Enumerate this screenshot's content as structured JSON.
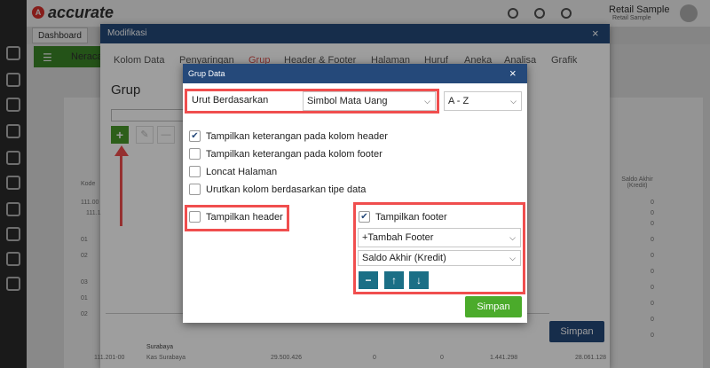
{
  "app": {
    "logo_text": "accurate",
    "user_name": "Retail Sample",
    "user_subtitle": "Retail Sample",
    "tab_dashboard": "Dashboard",
    "page_title": "Neraca"
  },
  "modifikasi": {
    "title": "Modifikasi",
    "close": "×",
    "tabs": [
      "Kolom Data",
      "Penyaringan",
      "Grup",
      "Header & Footer",
      "Halaman",
      "Huruf",
      "Aneka",
      "Analisa",
      "Grafik"
    ],
    "active_tab": "Grup",
    "section_title": "Grup",
    "add_icon": "+",
    "edit_icon": "✎",
    "delete_icon": "—",
    "save_button": "Simpan"
  },
  "background_report": {
    "col_kode": "Kode",
    "col_saldo": "Saldo Akhir (Kredit)",
    "row_codes": [
      "111.00",
      "111.1",
      "01",
      "02",
      "03",
      "01",
      "02",
      "03",
      "04"
    ],
    "zeros": [
      "0",
      "0",
      "0",
      "0",
      "0",
      "0",
      "0",
      "0",
      "0",
      "0"
    ],
    "footer_row": {
      "group": "Surabaya",
      "code": "111.201-00",
      "name": "Kas Surabaya",
      "v1": "29.500.426",
      "v2": "0",
      "v3": "0",
      "v4": "1.441.298",
      "v5": "28.061.128"
    }
  },
  "grup_dialog": {
    "title": "Grup Data",
    "close": "×",
    "sort_label": "Urut Berdasarkan",
    "sort_field": "Simbol Mata Uang",
    "sort_order": "A - Z",
    "options": [
      {
        "label": "Tampilkan keterangan pada kolom header",
        "checked": true
      },
      {
        "label": "Tampilkan keterangan pada kolom footer",
        "checked": false
      },
      {
        "label": "Loncat Halaman",
        "checked": false
      },
      {
        "label": "Urutkan kolom berdasarkan tipe data",
        "checked": false
      }
    ],
    "show_header": {
      "label": "Tampilkan header",
      "checked": false
    },
    "show_footer": {
      "label": "Tampilkan footer",
      "checked": true
    },
    "add_footer": "+Tambah Footer",
    "footer_field": "Saldo Akhir (Kredit)",
    "btn_remove": "−",
    "btn_up": "↑",
    "btn_down": "↓",
    "save_button": "Simpan"
  },
  "colors": {
    "header_blue": "#25497a",
    "save_green": "#4bab2b",
    "highlight_red": "#f04e4e",
    "teal_buttons": "#1b6f86"
  }
}
